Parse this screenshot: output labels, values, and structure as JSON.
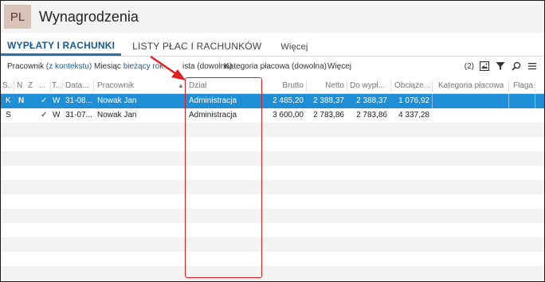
{
  "app": {
    "badge": "PL",
    "title": "Wynagrodzenia"
  },
  "tabs": [
    {
      "label": "WYPŁATY I RACHUNKI",
      "active": true
    },
    {
      "label": "LISTY PŁAC I RACHUNKÓW",
      "active": false
    },
    {
      "label": "Więcej",
      "active": false
    }
  ],
  "filters": {
    "pracownik_label": "Pracownik",
    "pracownik_value": "(z kontekstu)",
    "miesiac_label": "Miesiąc",
    "miesiac_value": "bieżący rok",
    "lista_label": "ista (dowolna)",
    "kategoria_label": "Kategoria płacowa (dowolna)",
    "more": "Więcej"
  },
  "toolbar": {
    "count": "(2)"
  },
  "grid": {
    "headers": {
      "s": "S...",
      "n": "N",
      "z": "Z",
      "dots": "...",
      "t": "T...",
      "data": "Data...",
      "pracownik": "Pracownik",
      "dzial": "Dział",
      "brutto": "Brutto",
      "netto": "Netto",
      "do_wyplaty": "Do wypł...",
      "obciazenia": "Obciąże...",
      "kategoria": "Kategoria płacowa",
      "flaga": "Flaga"
    },
    "rows": [
      {
        "s": "K",
        "n": "N",
        "z": "",
        "check": "✓",
        "t": "W",
        "data": "31-08...",
        "pracownik": "Nowak Jan",
        "dzial": "Administracja",
        "brutto": "2 485,20",
        "netto": "2 388,37",
        "do_wyplaty": "2 388,37",
        "obciazenia": "1 076,92",
        "kategoria": "",
        "flaga": ""
      },
      {
        "s": "S",
        "n": "",
        "z": "",
        "check": "✓",
        "t": "W",
        "data": "31-07...",
        "pracownik": "Nowak Jan",
        "dzial": "Administracja",
        "brutto": "3 600,00",
        "netto": "2 783,86",
        "do_wyplaty": "2 783,86",
        "obciazenia": "4 337,28",
        "kategoria": "",
        "flaga": ""
      }
    ]
  },
  "colors": {
    "selected_row": "#1e8fd6",
    "active_tab": "#2a6fa8",
    "annotation": "#e02020",
    "link": "#1f5f96"
  }
}
